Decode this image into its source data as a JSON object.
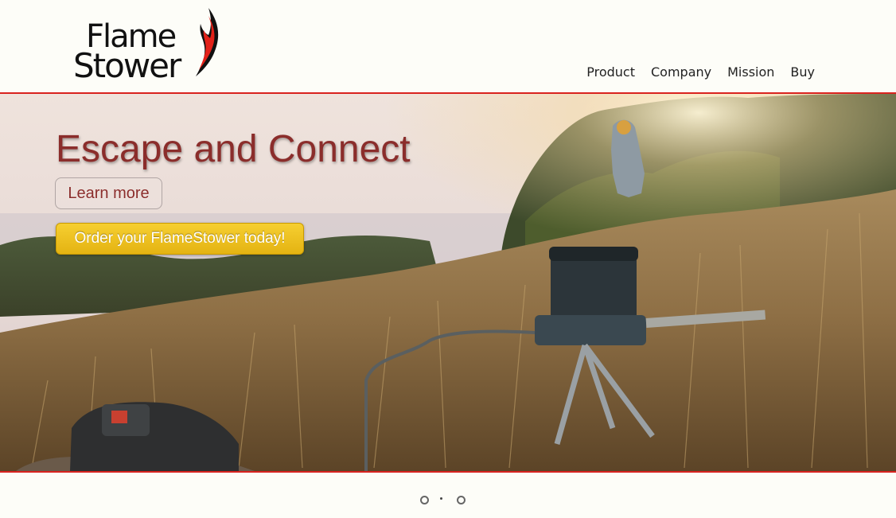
{
  "brand": {
    "logo_line1": "Flame",
    "logo_line2": "Stower",
    "flame_icon": "flame-icon",
    "accent_color": "#d9231f"
  },
  "nav": {
    "items": [
      {
        "label": "Product"
      },
      {
        "label": "Company"
      },
      {
        "label": "Mission"
      },
      {
        "label": "Buy"
      }
    ]
  },
  "hero": {
    "title": "Escape and Connect",
    "learn_more_label": "Learn more",
    "order_label": "Order your FlameStower today!",
    "title_color": "#8b2d2b",
    "order_button_color": "#f2c423"
  },
  "carousel": {
    "slide_count": 3,
    "active_index": 1
  }
}
